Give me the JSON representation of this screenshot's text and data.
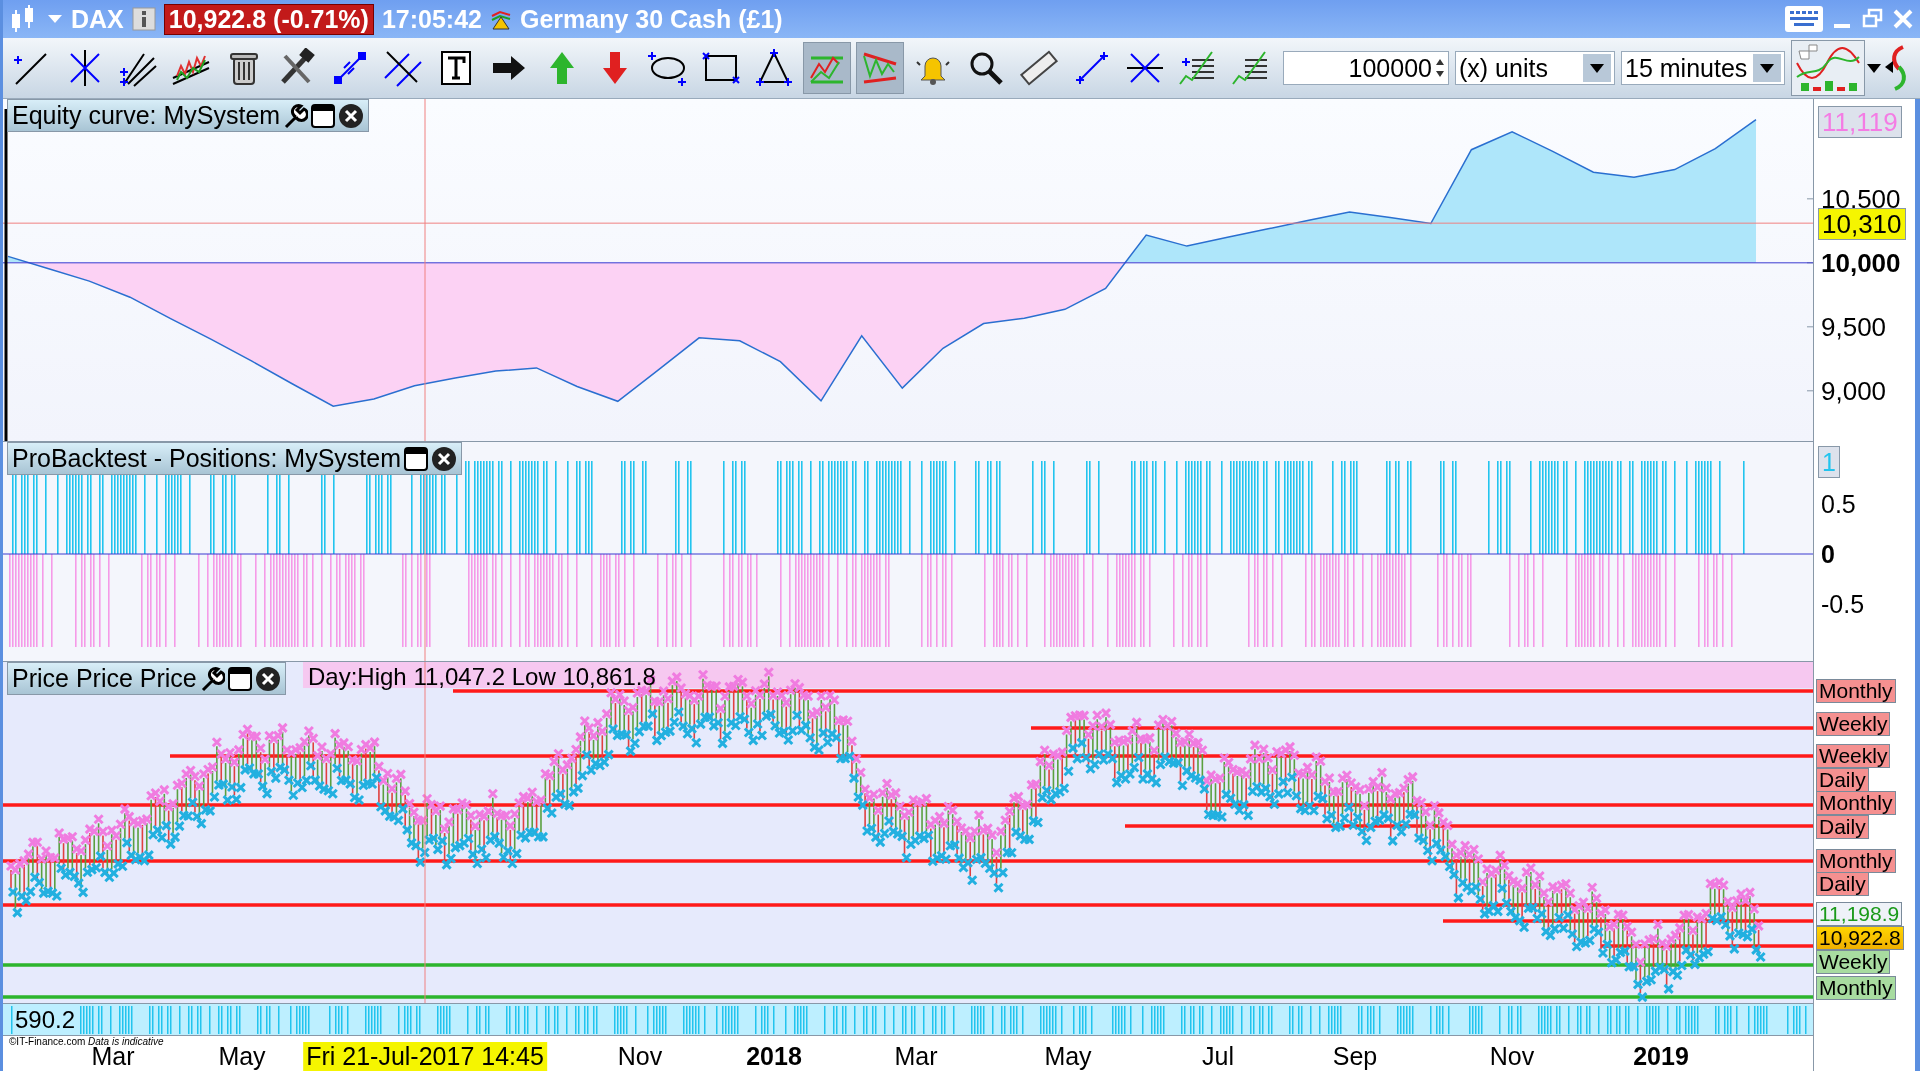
{
  "title_bar": {
    "instrument": "DAX",
    "price_change": "10,922.8 (-0.71%)",
    "time": "17:05:42",
    "market_name": "Germany 30 Cash (£1)"
  },
  "toolbar": {
    "tools": [
      {
        "kind": "line",
        "selected": false
      },
      {
        "kind": "vline",
        "selected": false
      },
      {
        "kind": "fan",
        "selected": false
      },
      {
        "kind": "zigzag",
        "selected": false
      },
      {
        "kind": "trash",
        "selected": false
      },
      {
        "kind": "tools",
        "selected": false
      },
      {
        "kind": "resize",
        "selected": false
      },
      {
        "kind": "parallel",
        "selected": false
      },
      {
        "kind": "text",
        "selected": false
      },
      {
        "kind": "arrow_right",
        "selected": false
      },
      {
        "kind": "arrow_up",
        "selected": false
      },
      {
        "kind": "arrow_down",
        "selected": false
      },
      {
        "kind": "ellipse",
        "selected": false
      },
      {
        "kind": "rectangle",
        "selected": false
      },
      {
        "kind": "triangle",
        "selected": false
      },
      {
        "kind": "trend",
        "selected": true
      },
      {
        "kind": "channel",
        "selected": true
      },
      {
        "kind": "bell",
        "selected": false
      },
      {
        "kind": "zoom",
        "selected": false
      },
      {
        "kind": "ruler",
        "selected": false
      },
      {
        "kind": "segment",
        "selected": false
      },
      {
        "kind": "hline",
        "selected": false
      },
      {
        "kind": "list_a",
        "selected": false
      },
      {
        "kind": "list_b",
        "selected": false
      }
    ],
    "quantity": "100000",
    "units": "(x) units",
    "timeframe": "15 minutes"
  },
  "equity_panel": {
    "chart_data": {
      "type": "line",
      "title": "Equity curve: MySystem",
      "ylim": [
        8600,
        11280
      ],
      "ref_lines": [
        {
          "axis": "y",
          "value": 10000,
          "color": "#3a3ad0"
        },
        {
          "axis": "y",
          "value": 10310,
          "color": "#f08080"
        }
      ],
      "yticks": [
        {
          "value": 9000,
          "label": "9,000"
        },
        {
          "value": 9500,
          "label": "9,500"
        },
        {
          "value": 10000,
          "label": "10,000"
        },
        {
          "value": 10500,
          "label": "10,500"
        }
      ],
      "series": [
        {
          "color": "#2a6fd0",
          "values": [
            10050,
            9953,
            9857,
            9731,
            9564,
            9402,
            9231,
            9053,
            8880,
            8936,
            9040,
            9099,
            9154,
            9179,
            9034,
            8918,
            9163,
            9414,
            9391,
            9228,
            8922,
            9430,
            9021,
            9332,
            9526,
            9567,
            9637,
            9800,
            10217,
            10131,
            10200,
            10266,
            10333,
            10398,
            10353,
            10307,
            10884,
            11024,
            10871,
            10708,
            10668,
            10728,
            10892,
            11119
          ]
        }
      ]
    },
    "axis_labels": [
      {
        "text": "11,119",
        "kind": "last"
      },
      {
        "text": "10,310",
        "kind": "cursor"
      }
    ]
  },
  "positions_panel": {
    "title": "ProBacktest - Positions: MySystem",
    "axis_labels": [
      {
        "text": "1",
        "kind": "last"
      },
      {
        "text": "0.5",
        "kind": "tick"
      },
      {
        "text": "0",
        "kind": "zero"
      },
      {
        "text": "-0.5",
        "kind": "tick"
      }
    ]
  },
  "price_panel": {
    "title": "Price Price Price",
    "day_range": "Day:High 11,047.2 Low 10,861.8",
    "volume_reading": "590.2",
    "axis_labels": [
      {
        "text": "Monthly",
        "kind": "resistance"
      },
      {
        "text": "Weekly",
        "kind": "resistance"
      },
      {
        "text": "Weekly",
        "kind": "resistance"
      },
      {
        "text": "Daily",
        "kind": "resistance"
      },
      {
        "text": "Monthly",
        "kind": "resistance"
      },
      {
        "text": "Daily",
        "kind": "resistance"
      },
      {
        "text": "Monthly",
        "kind": "resistance"
      },
      {
        "text": "Daily",
        "kind": "resistance"
      },
      {
        "text": "11,198.9",
        "kind": "high"
      },
      {
        "text": "10,922.8",
        "kind": "last"
      },
      {
        "text": "Weekly",
        "kind": "support"
      },
      {
        "text": "Monthly",
        "kind": "support"
      }
    ]
  },
  "x_axis": {
    "labels": [
      {
        "text": "Mar",
        "kind": "month"
      },
      {
        "text": "May",
        "kind": "month"
      },
      {
        "text": "Fri 21-Jul-2017 14:45",
        "kind": "cursor"
      },
      {
        "text": "Nov",
        "kind": "month"
      },
      {
        "text": "2018",
        "kind": "year"
      },
      {
        "text": "Mar",
        "kind": "month"
      },
      {
        "text": "May",
        "kind": "month"
      },
      {
        "text": "Jul",
        "kind": "month"
      },
      {
        "text": "Sep",
        "kind": "month"
      },
      {
        "text": "Nov",
        "kind": "month"
      },
      {
        "text": "2019",
        "kind": "year"
      }
    ]
  },
  "footer_note": "©IT-Finance.com *Data is indicative*"
}
